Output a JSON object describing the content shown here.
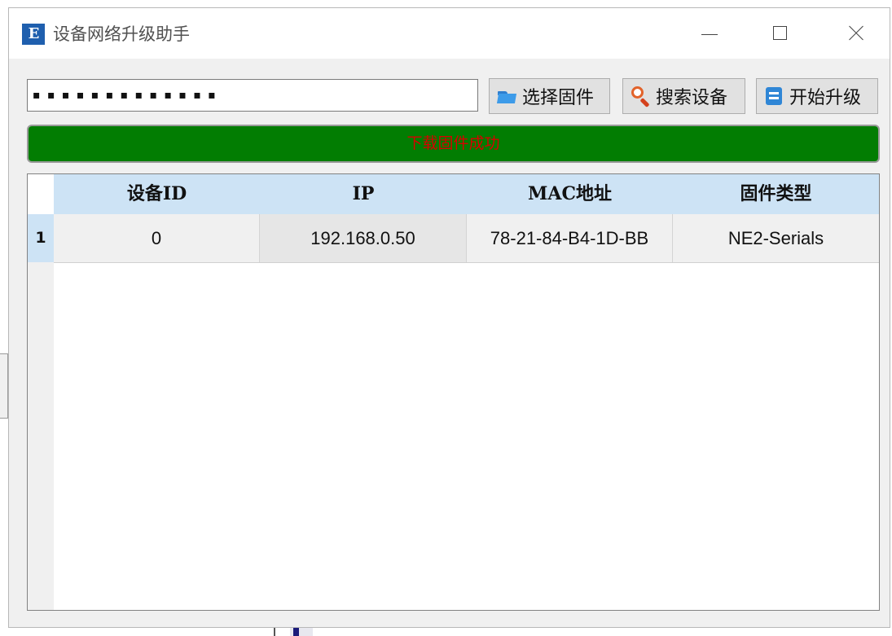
{
  "window": {
    "title": "设备网络升级助手",
    "icon_text": "E"
  },
  "toolbar": {
    "firmware_path": "▪ ▪ ▪  ▪   ▪   ▪  ▪ ▪ ▪  ▪ ▪ ▪ ▪",
    "select_firmware_label": "选择固件",
    "search_devices_label": "搜索设备",
    "start_upgrade_label": "开始升级"
  },
  "progress": {
    "status_text": "下载固件成功",
    "fill_percent": 100,
    "fill_color": "#027d02",
    "text_color": "#d80000"
  },
  "grid": {
    "columns": [
      "设备ID",
      "IP",
      "MAC地址",
      "固件类型"
    ],
    "rows": [
      {
        "index": "1",
        "device_id": "0",
        "ip": "192.168.0.50",
        "mac": "78-21-84-B4-1D-BB",
        "firmware_type": "NE2-Serials"
      }
    ]
  },
  "colors": {
    "header_bg": "#cde3f5",
    "window_bg": "#f0f0f0"
  }
}
